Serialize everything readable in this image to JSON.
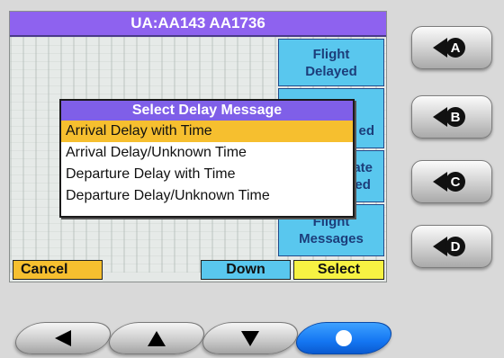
{
  "screen": {
    "title": "UA:AA143  AA1736",
    "side_buttons": [
      {
        "line1": "Flight",
        "line2": "Delayed"
      },
      {
        "line1": "",
        "line2": "ed"
      },
      {
        "line1": "ate",
        "line2": "ed"
      },
      {
        "line1": "Flight",
        "line2": "Messages"
      }
    ],
    "softkeys": {
      "cancel": "Cancel",
      "down": "Down",
      "select": "Select"
    }
  },
  "dialog": {
    "title": "Select Delay Message",
    "options": [
      {
        "label": "Arrival Delay with Time",
        "selected": true
      },
      {
        "label": "Arrival Delay/Unknown Time",
        "selected": false
      },
      {
        "label": "Departure Delay with Time",
        "selected": false
      },
      {
        "label": "Departure Delay/Unknown Time",
        "selected": false
      }
    ]
  },
  "hardware_buttons": [
    {
      "letter": "A",
      "icon": "speaker-a-icon"
    },
    {
      "letter": "B",
      "icon": "speaker-b-icon"
    },
    {
      "letter": "C",
      "icon": "speaker-c-icon"
    },
    {
      "letter": "D",
      "icon": "speaker-d-icon"
    }
  ],
  "nav_buttons": [
    {
      "icon": "arrow-left-icon"
    },
    {
      "icon": "arrow-up-icon"
    },
    {
      "icon": "arrow-down-icon"
    },
    {
      "icon": "circle-icon",
      "active": true
    }
  ],
  "colors": {
    "title_bar": "#8e62ef",
    "side_button": "#59c7ee",
    "cancel_key": "#f6bf2f",
    "down_key": "#59c7ee",
    "select_key": "#f7f243",
    "selection_highlight": "#f6bf2f",
    "nav_active": "#1476f2"
  }
}
